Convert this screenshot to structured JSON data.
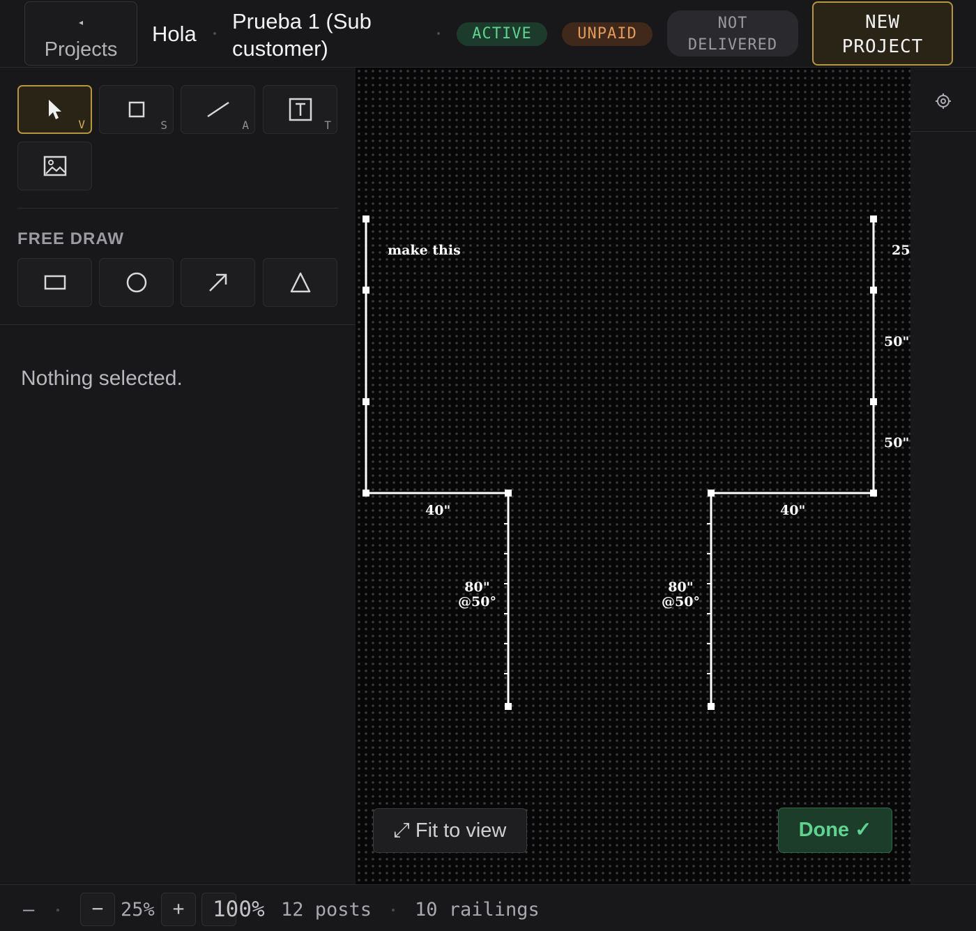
{
  "header": {
    "back_chevron": "◂",
    "back_label": "Projects",
    "breadcrumb_root": "Hola",
    "project_title_line1": "Prueba 1 (Sub",
    "project_title_line2": "customer)",
    "status_active": "ACTIVE",
    "status_unpaid": "UNPAID",
    "status_delivery_line1": "NOT",
    "status_delivery_line2": "DELIVERED",
    "new_project_line1": "NEW",
    "new_project_line2": "PROJECT"
  },
  "tools": [
    {
      "name": "select",
      "icon": "cursor-icon",
      "key": "V",
      "active": true
    },
    {
      "name": "rectangle",
      "icon": "square-icon",
      "key": "S",
      "active": false
    },
    {
      "name": "line",
      "icon": "line-icon",
      "key": "A",
      "active": false
    },
    {
      "name": "text",
      "icon": "text-box-icon",
      "key": "T",
      "active": false
    },
    {
      "name": "image",
      "icon": "image-icon",
      "key": "",
      "active": false
    }
  ],
  "free_draw": {
    "title": "FREE DRAW",
    "shapes": [
      "rectangle-icon",
      "circle-icon",
      "arrow-icon",
      "triangle-icon"
    ]
  },
  "selection": {
    "empty_text": "Nothing selected."
  },
  "canvas": {
    "note_text": "make this",
    "labels": {
      "top_right": "25",
      "right_mid_1": "50\"",
      "right_mid_2": "50\"",
      "bottom_left_run": "40\"",
      "bottom_right_run": "40\"",
      "left_leg_line1": "80\"",
      "left_leg_line2": "@50°",
      "right_leg_line1": "80\"",
      "right_leg_line2": "@50°"
    },
    "fit_button": "⤢ Fit to view",
    "done_button": "Done ✓"
  },
  "right_panel": {
    "icon": "gear-icon"
  },
  "footer": {
    "dash": "—",
    "zoom_out": "−",
    "zoom_level": "25%",
    "zoom_in": "+",
    "reset_zoom": "100%",
    "posts": "12 posts",
    "railings": "10 railings"
  },
  "colors": {
    "accent_gold": "#b8963f",
    "active_green": "#5fd38f",
    "unpaid_orange": "#e09a5c",
    "background": "#18181b",
    "canvas": "#070708"
  }
}
